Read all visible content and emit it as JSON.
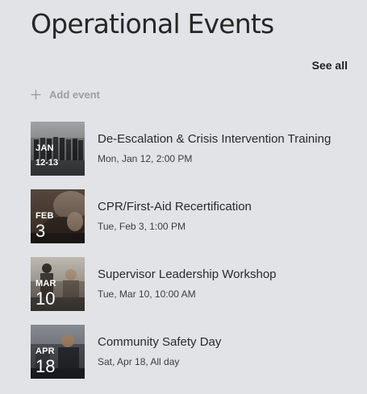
{
  "header": {
    "title": "Operational Events",
    "see_all_label": "See all"
  },
  "actions": {
    "add_event_label": "Add event",
    "add_icon": "plus-icon"
  },
  "events": [
    {
      "month": "JAN",
      "day": "12-13",
      "title": "De-Escalation & Crisis Intervention Training",
      "datetime": "Mon, Jan 12, 2:00 PM"
    },
    {
      "month": "FEB",
      "day": "3",
      "title": "CPR/First-Aid Recertification",
      "datetime": "Tue, Feb 3, 1:00 PM"
    },
    {
      "month": "MAR",
      "day": "10",
      "title": "Supervisor Leadership Workshop",
      "datetime": "Tue, Mar 10, 10:00 AM"
    },
    {
      "month": "APR",
      "day": "18",
      "title": "Community Safety Day",
      "datetime": "Sat, Apr 18, All day"
    }
  ],
  "colors": {
    "background": "#e1e3e7",
    "muted_text": "#9a9ea4"
  }
}
